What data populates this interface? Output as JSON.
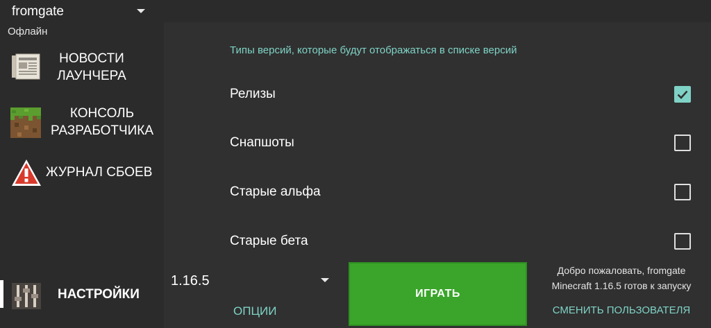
{
  "account": {
    "name": "fromgate",
    "status": "Офлайн"
  },
  "sidebar": {
    "items": [
      {
        "label": "НОВОСТИ ЛАУНЧЕРА",
        "icon": "newspaper-icon"
      },
      {
        "label": "КОНСОЛЬ РАЗРАБОТЧИКА",
        "icon": "grass-block-icon"
      },
      {
        "label": "ЖУРНАЛ СБОЕВ",
        "icon": "warning-icon"
      },
      {
        "label": "НАСТРОЙКИ",
        "icon": "sliders-icon",
        "active": true
      }
    ]
  },
  "settings": {
    "section_title": "Типы версий, которые будут отображаться в списке версий",
    "options": [
      {
        "label": "Релизы",
        "checked": true
      },
      {
        "label": "Снапшоты",
        "checked": false
      },
      {
        "label": "Старые альфа",
        "checked": false
      },
      {
        "label": "Старые бета",
        "checked": false
      }
    ]
  },
  "bottom": {
    "version": "1.16.5",
    "options_label": "ОПЦИИ",
    "play_label": "ИГРАТЬ",
    "welcome_line1": "Добро пожаловать, fromgate",
    "welcome_line2": "Minecraft 1.16.5 готов к запуску",
    "switch_user_label": "СМЕНИТЬ ПОЛЬЗОВАТЕЛЯ"
  },
  "colors": {
    "accent": "#7fd3c6",
    "play_green": "#3aa52a",
    "background": "#303030",
    "sidebar": "#2b2b2b"
  }
}
